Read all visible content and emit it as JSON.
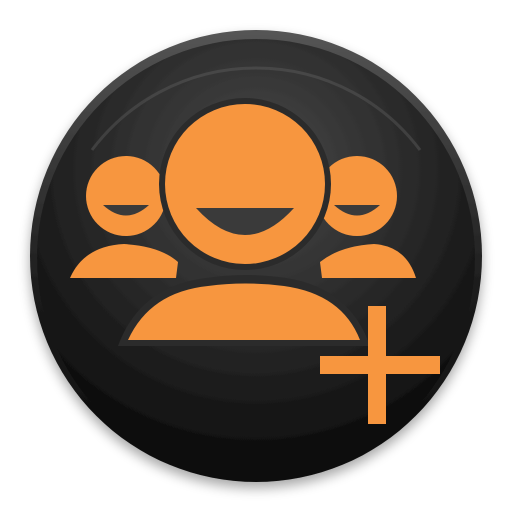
{
  "app_icon": {
    "name": "add-group-app-icon",
    "glyphs": [
      "group-people-icon",
      "plus-icon"
    ],
    "colors": {
      "accent": "#F7963F",
      "disc_dark": "#0E0E0E",
      "disc_mid": "#2A2A2A",
      "disc_highlight": "#4A4A4A",
      "rim": "#555555",
      "mouth": "#3A3A3A"
    }
  }
}
